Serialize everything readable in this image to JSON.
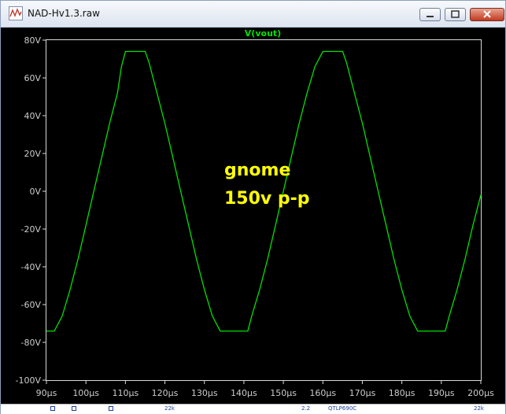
{
  "window": {
    "title": "NAD-Hv1.3.raw",
    "icon": "waveform-icon"
  },
  "plot": {
    "trace_label": "V(vout)",
    "trace_color": "#00e000",
    "background": "#000000",
    "axis_text_color": "#cccccc",
    "annotation_color": "#ffff00",
    "annotations": [
      "gnome",
      "150v p-p"
    ]
  },
  "chart_data": {
    "type": "line",
    "title": "V(vout)",
    "xlabel": "",
    "ylabel": "",
    "xlim": [
      90,
      200
    ],
    "ylim": [
      -100,
      80
    ],
    "x_unit": "µs",
    "y_unit": "V",
    "x_ticks": [
      "90µs",
      "100µs",
      "110µs",
      "120µs",
      "130µs",
      "140µs",
      "150µs",
      "160µs",
      "170µs",
      "180µs",
      "190µs",
      "200µs"
    ],
    "y_ticks": [
      "80V",
      "60V",
      "40V",
      "20V",
      "0V",
      "-20V",
      "-40V",
      "-60V",
      "-80V",
      "-100V"
    ],
    "grid": false,
    "series": [
      {
        "name": "V(vout)",
        "x": [
          90,
          92,
          94,
          96,
          98,
          100,
          102,
          104,
          106,
          108,
          109,
          110,
          112,
          114,
          115,
          116,
          118,
          120,
          122,
          124,
          126,
          128,
          130,
          132,
          134,
          136,
          138,
          140,
          141,
          142,
          144,
          146,
          148,
          150,
          152,
          154,
          156,
          158,
          160,
          162,
          164,
          165,
          166,
          168,
          170,
          172,
          174,
          176,
          178,
          180,
          182,
          184,
          186,
          188,
          190,
          191,
          192,
          194,
          196,
          198,
          200
        ],
        "y": [
          -74,
          -74,
          -66,
          -52,
          -36,
          -18,
          0,
          18,
          36,
          52,
          66,
          74,
          74,
          74,
          74,
          68,
          52,
          36,
          18,
          0,
          -18,
          -36,
          -52,
          -66,
          -74,
          -74,
          -74,
          -74,
          -74,
          -66,
          -52,
          -36,
          -18,
          0,
          18,
          36,
          52,
          66,
          74,
          74,
          74,
          74,
          68,
          52,
          36,
          18,
          0,
          -18,
          -36,
          -52,
          -66,
          -74,
          -74,
          -74,
          -74,
          -74,
          -66,
          -52,
          -36,
          -18,
          -2
        ]
      }
    ]
  },
  "taskbar": {
    "items": [
      "22k",
      "2.2",
      "QTLP690C",
      "22k"
    ]
  }
}
